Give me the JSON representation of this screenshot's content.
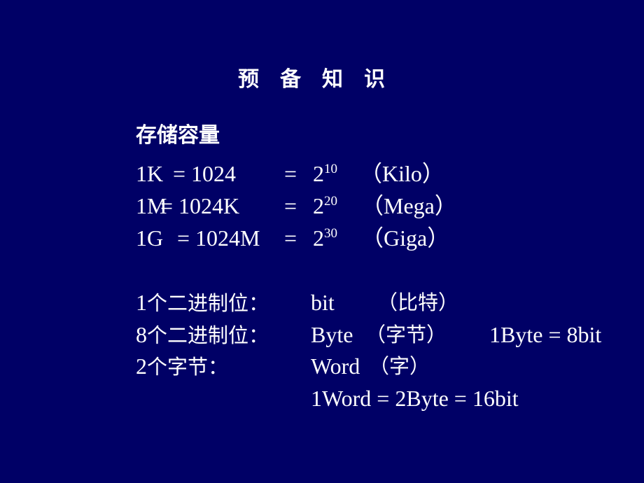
{
  "slide": {
    "background_color": "#000066",
    "text_color": "#ffffff",
    "title_chars": [
      "预",
      "备",
      "知",
      "识"
    ],
    "subtitle": "存储容量",
    "units": [
      {
        "lhs": "1K",
        "eq1": "= 1024",
        "eq2": "=",
        "base": "2",
        "exp": "10",
        "name": "（Kilo）"
      },
      {
        "lhs": "1M",
        "eq1": "= 1024K",
        "eq2": "=",
        "base": "2",
        "exp": "20",
        "name": "（Mega）"
      },
      {
        "lhs": "1G",
        "eq1": "= 1024M",
        "eq2": "=",
        "base": "2",
        "exp": "30",
        "name": "（Giga）"
      }
    ],
    "definitions": [
      {
        "count": "1",
        "label": "个二进制位：",
        "term": "bit",
        "meaning": "（比特）",
        "note": ""
      },
      {
        "count": "8",
        "label": "个二进制位：",
        "term": "Byte",
        "meaning": "（字节）",
        "note": "1Byte = 8bit"
      },
      {
        "count": "2",
        "label": "个字节：",
        "term": "Word",
        "meaning": "（字）",
        "note": ""
      }
    ],
    "word_equation": "1Word = 2Byte = 16bit"
  }
}
